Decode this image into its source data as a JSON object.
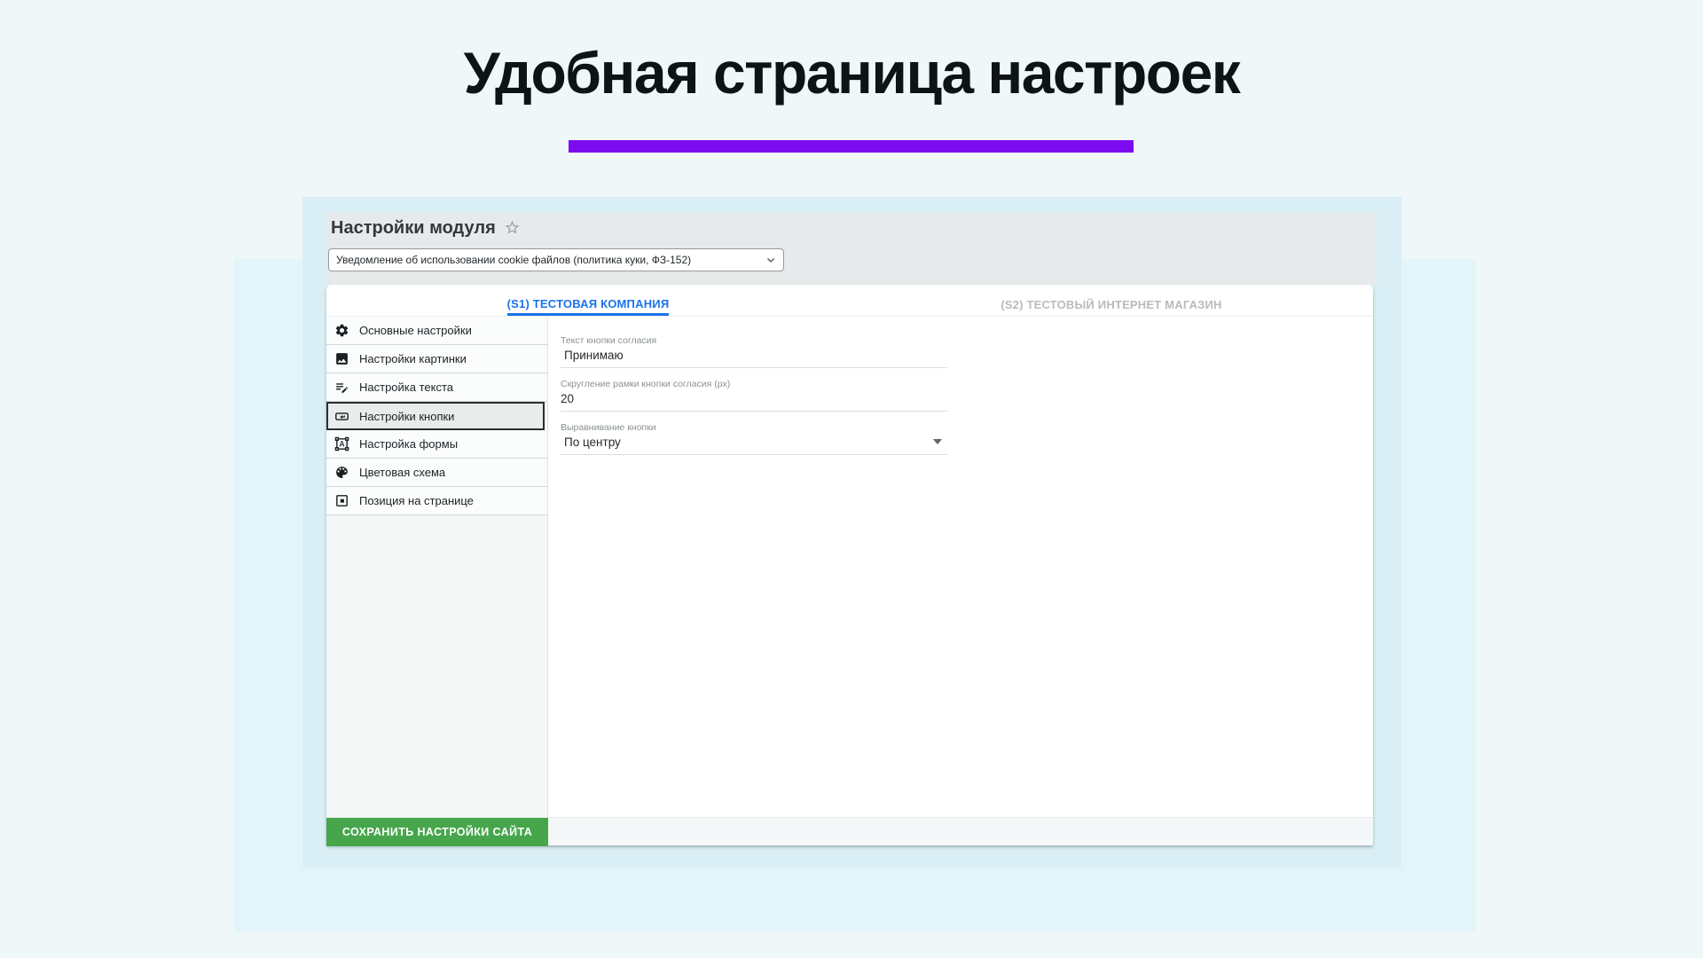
{
  "page": {
    "title": "Удобная страница настроек"
  },
  "panel": {
    "title": "Настройки модуля",
    "module_select": {
      "value": "Уведомление об использовании cookie файлов (политика куки, ФЗ-152)"
    },
    "tabs": [
      {
        "label": "(S1) ТЕСТОВАЯ КОМПАНИЯ",
        "active": true
      },
      {
        "label": "(S2) ТЕСТОВЫЙ ИНТЕРНЕТ МАГАЗИН",
        "active": false
      }
    ],
    "sidebar": {
      "items": [
        {
          "icon": "gear-icon",
          "label": "Основные настройки",
          "selected": false
        },
        {
          "icon": "image-icon",
          "label": "Настройки картинки",
          "selected": false
        },
        {
          "icon": "text-edit-icon",
          "label": "Настройка текста",
          "selected": false
        },
        {
          "icon": "button-icon",
          "label": "Настройки кнопки",
          "selected": true
        },
        {
          "icon": "form-shapes-icon",
          "label": "Настройка формы",
          "selected": false
        },
        {
          "icon": "palette-icon",
          "label": "Цветовая схема",
          "selected": false
        },
        {
          "icon": "position-icon",
          "label": "Позиция на странице",
          "selected": false
        }
      ]
    },
    "form": {
      "fields": [
        {
          "label": "Текст кнопки согласия",
          "value": "Принимаю",
          "type": "text"
        },
        {
          "label": "Скругление рамки кнопки согласия (px)",
          "value": "20",
          "type": "text"
        },
        {
          "label": "Выравнивание кнопки",
          "value": "По центру",
          "type": "select"
        }
      ]
    },
    "save_button": {
      "label": "СОХРАНИТЬ НАСТРОЙКИ САЙТА"
    }
  },
  "colors": {
    "accent_blue": "#1a73e8",
    "accent_purple": "#7d0bf0",
    "save_green": "#47a64c",
    "container_cyan": "#daeff5",
    "background": "#eff7f9"
  }
}
